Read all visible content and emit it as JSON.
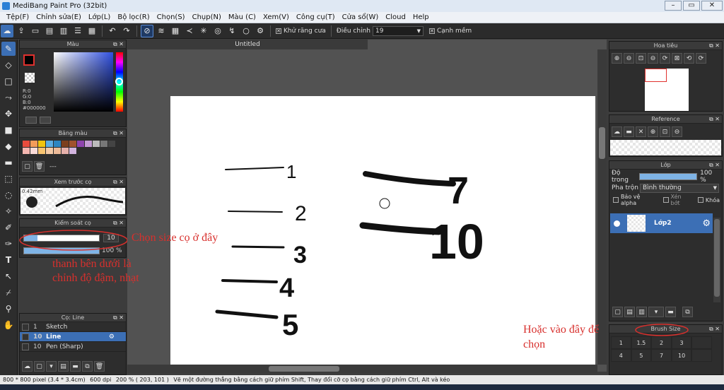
{
  "window": {
    "title": "MediBang Paint Pro (32bit)",
    "min": "–",
    "max": "▭",
    "close": "✕"
  },
  "menu": [
    "Tệp(F)",
    "Chỉnh sửa(E)",
    "Lớp(L)",
    "Bộ lọc(R)",
    "Chọn(S)",
    "Chụp(N)",
    "Màu (C)",
    "Xem(V)",
    "Công cụ(T)",
    "Cửa sổ(W)",
    "Cloud",
    "Help"
  ],
  "toolbar": {
    "antialias_label": "Khử răng cưa",
    "adjust_label": "Điều chỉnh",
    "adjust_value": "19",
    "smooth_label": "Cạnh mềm"
  },
  "document": {
    "tab": "Untitled"
  },
  "color_panel": {
    "title": "Màu",
    "r": "R:0",
    "g": "G:0",
    "b": "B:0",
    "hex": "#000000"
  },
  "palette_panel": {
    "title": "Bảng màu",
    "dash": "---"
  },
  "preview_panel": {
    "title": "Xem trước cọ",
    "size": "0.42mm"
  },
  "brush_control": {
    "title": "Kiểm soát cọ",
    "size_value": "10",
    "opacity_value": "100 %"
  },
  "brush_list": {
    "title": "Cọ: Line",
    "items": [
      {
        "num": "1",
        "name": "Sketch",
        "selected": false
      },
      {
        "num": "10",
        "name": "Line",
        "selected": true
      },
      {
        "num": "10",
        "name": "Pen (Sharp)",
        "selected": false
      }
    ]
  },
  "navigator": {
    "title": "Hoa tiêu"
  },
  "reference": {
    "title": "Reference"
  },
  "layer_panel": {
    "title": "Lớp",
    "opacity_label": "Độ trong",
    "opacity_value": "100 %",
    "blend_label": "Pha trộn",
    "blend_value": "Bình thường",
    "protect_alpha": "Bảo vệ alpha",
    "clipping": "Xén bớt",
    "lock": "Khóa",
    "layer_name": "Lớp2"
  },
  "brush_size_panel": {
    "title": "Brush Size",
    "sizes": [
      "1",
      "1.5",
      "2",
      "3",
      "",
      "4",
      "5",
      "7",
      "10",
      ""
    ]
  },
  "annotations": {
    "size_here": "Chọn size cọ ở đây",
    "bar_below_1": "thanh bên dưới là",
    "bar_below_2": "chỉnh độ đậm, nhạt",
    "or_here_1": "Hoặc vào đây để",
    "or_here_2": "chọn"
  },
  "canvas_labels": [
    "1",
    "2",
    "3",
    "4",
    "5",
    "7",
    "10"
  ],
  "statusbar": {
    "size": "800 * 800 pixel",
    "cm": "(3.4 * 3.4cm)",
    "dpi": "600 dpi",
    "zoom": "200 %",
    "coords": "( 203, 101 )",
    "hint": "Vẽ một đường thẳng bằng cách giữ phím Shift, Thay đổi cỡ cọ bằng cách giữ phím Ctrl, Alt và kéo"
  },
  "colors": {
    "accent": "#3c6fb5",
    "annotation": "#d8302d",
    "panel": "#2d2d2d"
  }
}
